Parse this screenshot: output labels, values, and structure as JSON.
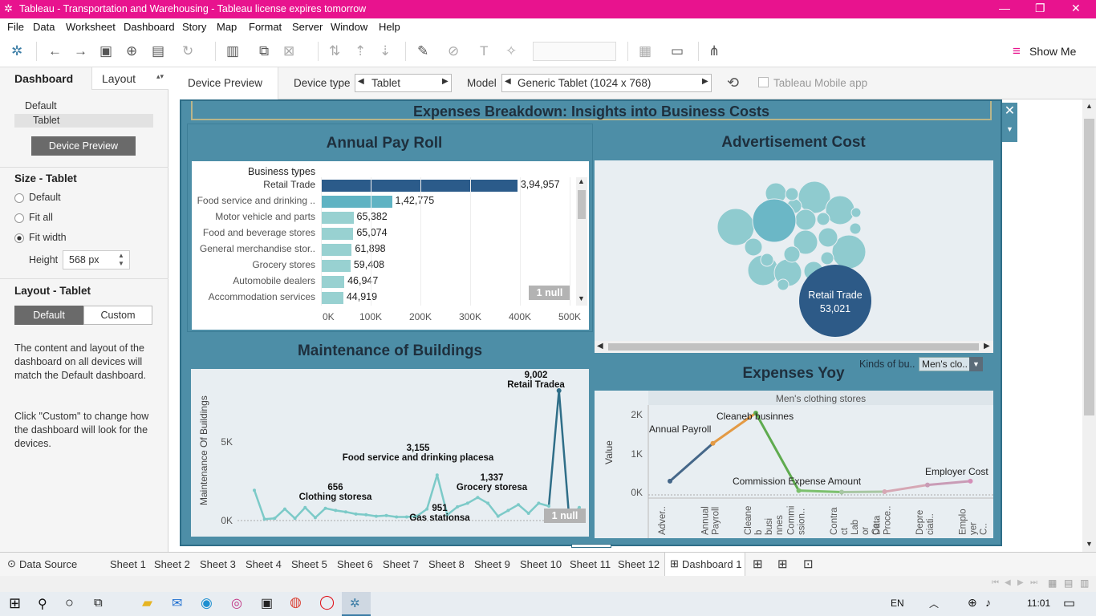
{
  "window": {
    "title": "Tableau - Transportation and Warehousing - Tableau license expires tomorrow"
  },
  "menu": [
    "File",
    "Data",
    "Worksheet",
    "Dashboard",
    "Story",
    "Map",
    "Format",
    "Server",
    "Window",
    "Help"
  ],
  "toolbar": {
    "show_me": "Show Me"
  },
  "left_pane": {
    "tab_dashboard": "Dashboard",
    "tab_layout": "Layout",
    "devices": [
      "Default",
      "Tablet"
    ],
    "device_preview_btn": "Device Preview",
    "size_heading": "Size - Tablet",
    "size_options": [
      "Default",
      "Fit all",
      "Fit width"
    ],
    "height_label": "Height",
    "height_value": "568 px",
    "layout_heading": "Layout - Tablet",
    "layout_default": "Default",
    "layout_custom": "Custom",
    "info1": "The content and layout of the dashboard on all devices will match the Default dashboard.",
    "info2": "Click \"Custom\" to change how the dashboard will look for the devices."
  },
  "device_bar": {
    "device_preview": "Device Preview",
    "device_type_label": "Device type",
    "device_type_value": "Tablet",
    "model_label": "Model",
    "model_value": "Generic Tablet (1024 x 768)",
    "mobile_app": "Tableau Mobile app"
  },
  "dashboard": {
    "title": "Expenses Breakdown: Insights into Business Costs",
    "payroll": {
      "title": "Annual Pay Roll",
      "header": "Business types",
      "null_badge": "1 null"
    },
    "advert": {
      "title": "Advertisement Cost",
      "bubble_label": "Retail Trade",
      "bubble_value": "53,021"
    },
    "maintenance": {
      "title": "Maintenance of Buildings",
      "ylabel": "Maintenance Of Buildings",
      "yticks": [
        "5K",
        "0K"
      ],
      "null_badge": "1 null",
      "annotations": [
        {
          "value": "9,002",
          "label": "Retail Tradea"
        },
        {
          "value": "3,155",
          "label": "Food service and drinking placesa"
        },
        {
          "value": "656",
          "label": "Clothing storesa"
        },
        {
          "value": "1,337",
          "label": "Grocery storesa"
        },
        {
          "value": "951",
          "label": "Gas stationsa"
        }
      ]
    },
    "yoy": {
      "title": "Expenses Yoy",
      "filter_label": "Kinds of bu..",
      "filter_value": "Men's clo..",
      "header": "Men's clothing stores",
      "ylabel": "Value",
      "yticks": [
        "2K",
        "1K",
        "0K"
      ],
      "xlabels": [
        "Adver..",
        "Annual Payroll",
        "Cleane b busi nnes",
        "Commi ssion..",
        "Contra ct Lab or Co..",
        "Data Proce..",
        "Depre ciati..",
        "Emplo yer C.."
      ],
      "annotations": [
        "Annual Payroll",
        "Cleaneb businnes",
        "Commission Expense Amount",
        "Employer Cost"
      ]
    }
  },
  "chart_data": [
    {
      "type": "bar",
      "title": "Annual Pay Roll",
      "categories": [
        "Retail Trade",
        "Food service and drinking ..",
        "Motor vehicle and parts",
        "Food and beverage stores",
        "General merchandise stor..",
        "Grocery stores",
        "Automobile dealers",
        "Accommodation services"
      ],
      "value_labels": [
        "3,94,957",
        "1,42,775",
        "65,382",
        "65,074",
        "61,898",
        "59,408",
        "46,947",
        "44,919"
      ],
      "values": [
        394957,
        142775,
        65382,
        65074,
        61898,
        59408,
        46947,
        44919
      ],
      "xticks": [
        "0K",
        "100K",
        "200K",
        "300K",
        "400K",
        "500K"
      ],
      "xlim": [
        0,
        500000
      ],
      "colors": [
        "#2b5b8a",
        "#5fb3c3",
        "#98d1d1"
      ]
    },
    {
      "type": "line",
      "title": "Maintenance of Buildings",
      "values": [
        2100,
        100,
        150,
        800,
        150,
        900,
        200,
        850,
        700,
        600,
        450,
        400,
        300,
        350,
        250,
        250,
        300,
        800,
        3155,
        400,
        951,
        1200,
        1600,
        1200,
        300,
        700,
        1100,
        500,
        1200,
        1000,
        9002,
        200,
        900
      ],
      "ylim": [
        0,
        10000
      ],
      "color": "#7ccac8",
      "peak_color": "#2f6e88"
    },
    {
      "type": "line",
      "title": "Expenses Yoy",
      "categories": [
        "Adver..",
        "Annual Payroll",
        "Cleane b busi nnes",
        "Commi ssion..",
        "Contra ct Lab or Co..",
        "Data Proce..",
        "Depre ciati..",
        "Emplo yer C.."
      ],
      "values": [
        300,
        1300,
        2100,
        50,
        10,
        20,
        200,
        300
      ],
      "ylim": [
        0,
        2300
      ]
    }
  ],
  "sheets": [
    "Data Source",
    "Sheet 1",
    "Sheet 2",
    "Sheet 3",
    "Sheet 4",
    "Sheet 5",
    "Sheet 6",
    "Sheet 7",
    "Sheet 8",
    "Sheet 9",
    "Sheet 10",
    "Sheet 11",
    "Sheet 12",
    "Dashboard 1"
  ],
  "taskbar": {
    "lang": "EN",
    "time": "11:01"
  }
}
